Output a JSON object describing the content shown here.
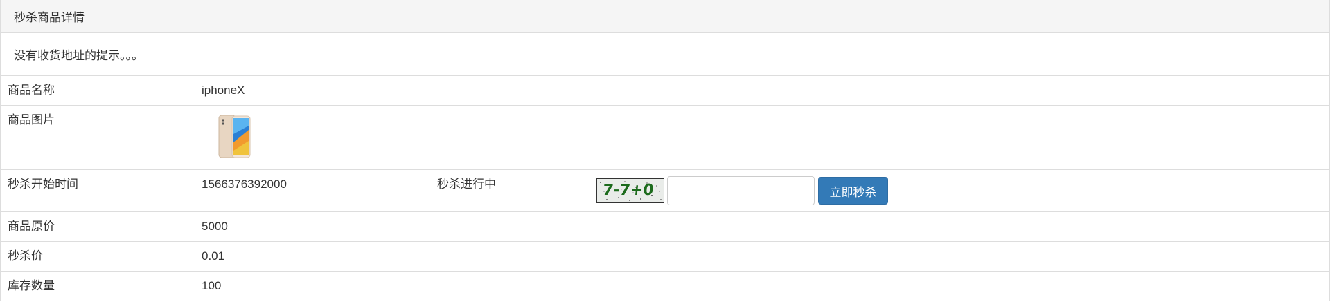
{
  "panel": {
    "title": "秒杀商品详情",
    "notice": "没有收货地址的提示。。。"
  },
  "goods": {
    "name_label": "商品名称",
    "name": "iphoneX",
    "image_label": "商品图片",
    "start_label": "秒杀开始时间",
    "start_time": "1566376392000",
    "status": "秒杀进行中",
    "captcha_text": "7-7+0",
    "verify_value": "",
    "buy_button": "立即秒杀",
    "price_label": "商品原价",
    "price": "5000",
    "seckill_price_label": "秒杀价",
    "seckill_price": "0.01",
    "stock_label": "库存数量",
    "stock": "100"
  },
  "colors": {
    "primary": "#337ab7",
    "heading_bg": "#f5f5f5",
    "border": "#dddddd",
    "captcha_text": "#1c6b1c"
  }
}
